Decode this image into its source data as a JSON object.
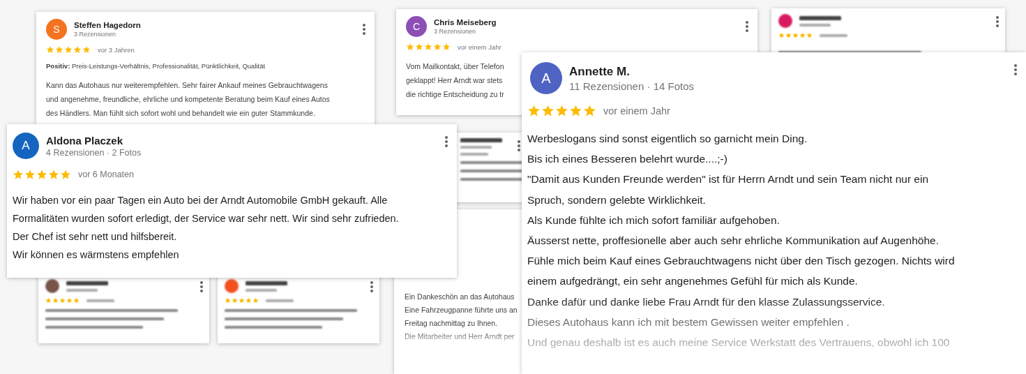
{
  "reviews": [
    {
      "kind": "full",
      "name": "Steffen Hagedorn",
      "initial": "S",
      "color": "#f4731f",
      "meta": "3 Rezensionen",
      "stars": 5,
      "time": "vor 3 Jahren",
      "highlights": "**Positiv:** Preis-Leistungs-Verhältnis, Professionalität, Pünktlichkeit, Qualität",
      "lines": [
        "Kann das Autohaus nur weiterempfehlen. Sehr fairer Ankauf meines Gebrauchtwagens",
        "und angenehme, freundliche, ehrliche und kompetente Beratung beim Kauf eines Autos",
        "des Händlers. Man fühlt sich sofort wohl und behandelt wie ein guter Stammkunde."
      ]
    },
    {
      "kind": "full",
      "name": "Chris Meiseberg",
      "initial": "C",
      "color": "#8d4fb5",
      "meta": "3 Rezensionen",
      "stars": 5,
      "time": "vor einem Jahr",
      "lines": [
        "Vom Mailkontakt, über Telefon",
        "geklappt! Herr Arndt war stets",
        "die richtige Entscheidung zu tr"
      ]
    },
    {
      "kind": "blurred",
      "color": "#d81b60",
      "stars": 5
    },
    {
      "kind": "blurred"
    },
    {
      "kind": "partial",
      "lines": [
        "Ein Dankeschön an das Autohaus",
        "Eine Fahrzeugpanne führte uns an",
        "Freitag nachmittag zu Ihnen.",
        "Die Mitarbeiter und Herr Arndt per"
      ]
    },
    {
      "kind": "blurred",
      "color": "#795548",
      "stars": 5
    },
    {
      "kind": "blurred",
      "color": "#f4511e",
      "stars": 5
    },
    {
      "kind": "full",
      "name": "Aldona Placzek",
      "initial": "A",
      "color": "#1565c0",
      "meta": "4 Rezensionen · 2 Fotos",
      "stars": 5,
      "time": "vor 6 Monaten",
      "lines": [
        "Wir haben vor ein paar Tagen ein Auto bei der Arndt Automobile GmbH gekauft. Alle",
        "Formalitäten wurden sofort erledigt, der Service war sehr nett. Wir sind sehr zufrieden.",
        "Der Chef ist sehr nett und hilfsbereit.",
        "Wir können es wärmstens empfehlen"
      ]
    },
    {
      "kind": "full",
      "name": "Annette M.",
      "initial": "A",
      "color": "#4e63c2",
      "meta": "11 Rezensionen · 14 Fotos",
      "stars": 5,
      "time": "vor einem Jahr",
      "lines": [
        "Werbeslogans sind sonst eigentlich so garnicht mein Ding.",
        "Bis ich eines Besseren belehrt wurde....;-)",
        "\"Damit aus Kunden Freunde werden\" ist für Herrn Arndt und sein Team nicht nur ein",
        "Spruch, sondern gelebte Wirklichkeit.",
        "Als Kunde fühlte ich mich sofort familiär aufgehoben.",
        "Äusserst nette, proffesionelle aber auch sehr ehrliche Kommunikation auf Augenhöhe.",
        "Fühle mich beim Kauf eines Gebrauchtwagens nicht über den Tisch gezogen. Nichts wird",
        "einem aufgedrängt, ein sehr angenehmes Gefühl für mich als Kunde.",
        "Danke dafür und danke liebe Frau Arndt für den klasse Zulassungsservice.",
        "Dieses Autohaus kann ich mit bestem Gewissen weiter empfehlen .",
        "Und genau deshalb ist es auch meine Service Werkstatt des Vertrauens, obwohl ich 100"
      ]
    }
  ]
}
